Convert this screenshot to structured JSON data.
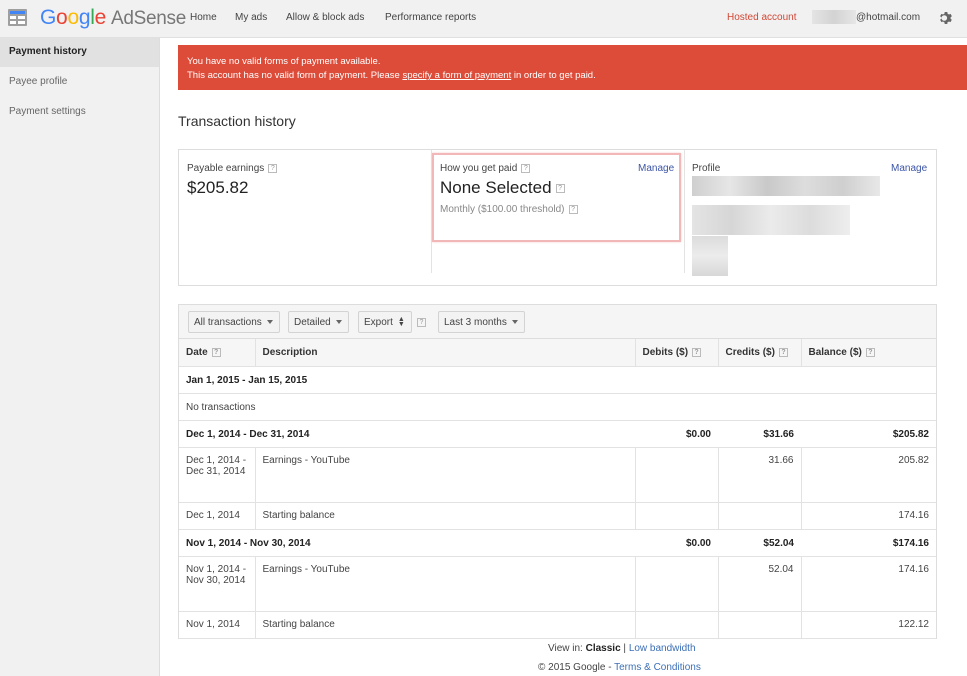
{
  "header": {
    "logo_google": [
      "G",
      "o",
      "o",
      "g",
      "l",
      "e"
    ],
    "logo_product": "AdSense",
    "nav": [
      "Home",
      "My ads",
      "Allow & block ads",
      "Performance reports"
    ],
    "hosted_account": "Hosted account",
    "email": "@hotmail.com"
  },
  "sidebar": {
    "items": [
      {
        "label": "Payment history",
        "active": true
      },
      {
        "label": "Payee profile",
        "active": false
      },
      {
        "label": "Payment settings",
        "active": false
      }
    ]
  },
  "alert": {
    "line1": "You have no valid forms of payment available.",
    "line2_before": "This account has no valid form of payment. Please ",
    "line2_link": "specify a form of payment",
    "line2_after": " in order to get paid."
  },
  "page_title": "Transaction history",
  "summary": {
    "payable_label": "Payable earnings",
    "payable_value": "$205.82",
    "paid_label": "How you get paid",
    "paid_manage": "Manage",
    "paid_value": "None Selected",
    "paid_threshold": "Monthly ($100.00 threshold)",
    "profile_label": "Profile",
    "profile_manage": "Manage",
    "help_glyph": "?"
  },
  "toolbar": {
    "all_transactions": "All transactions",
    "detailed": "Detailed",
    "export": "Export",
    "range": "Last 3 months"
  },
  "table": {
    "headers": [
      "Date",
      "Description",
      "Debits ($)",
      "Credits ($)",
      "Balance ($)"
    ],
    "periods": [
      {
        "label": "Jan 1, 2015 - Jan 15, 2015",
        "note": "No transactions"
      },
      {
        "label": "Dec 1, 2014 - Dec 31, 2014",
        "debits": "$0.00",
        "credits": "$31.66",
        "balance": "$205.82",
        "rows": [
          {
            "date": "Dec 1, 2014 - Dec 31, 2014",
            "desc": "Earnings - YouTube",
            "debit": "",
            "credit": "31.66",
            "balance": "205.82"
          },
          {
            "date": "Dec 1, 2014",
            "desc": "Starting balance",
            "debit": "",
            "credit": "",
            "balance": "174.16"
          }
        ]
      },
      {
        "label": "Nov 1, 2014 - Nov 30, 2014",
        "debits": "$0.00",
        "credits": "$52.04",
        "balance": "$174.16",
        "rows": [
          {
            "date": "Nov 1, 2014 - Nov 30, 2014",
            "desc": "Earnings - YouTube",
            "debit": "",
            "credit": "52.04",
            "balance": "174.16"
          },
          {
            "date": "Nov 1, 2014",
            "desc": "Starting balance",
            "debit": "",
            "credit": "",
            "balance": "122.12"
          }
        ]
      }
    ]
  },
  "footer": {
    "view_in": "View in: ",
    "classic": "Classic",
    "sep": " | ",
    "low_bandwidth": "Low bandwidth",
    "copyright": "© 2015 Google - ",
    "terms": "Terms & Conditions"
  },
  "colors": {
    "alert_bg": "#dd4b39",
    "link": "#3b54a5",
    "hosted": "#d14836"
  }
}
